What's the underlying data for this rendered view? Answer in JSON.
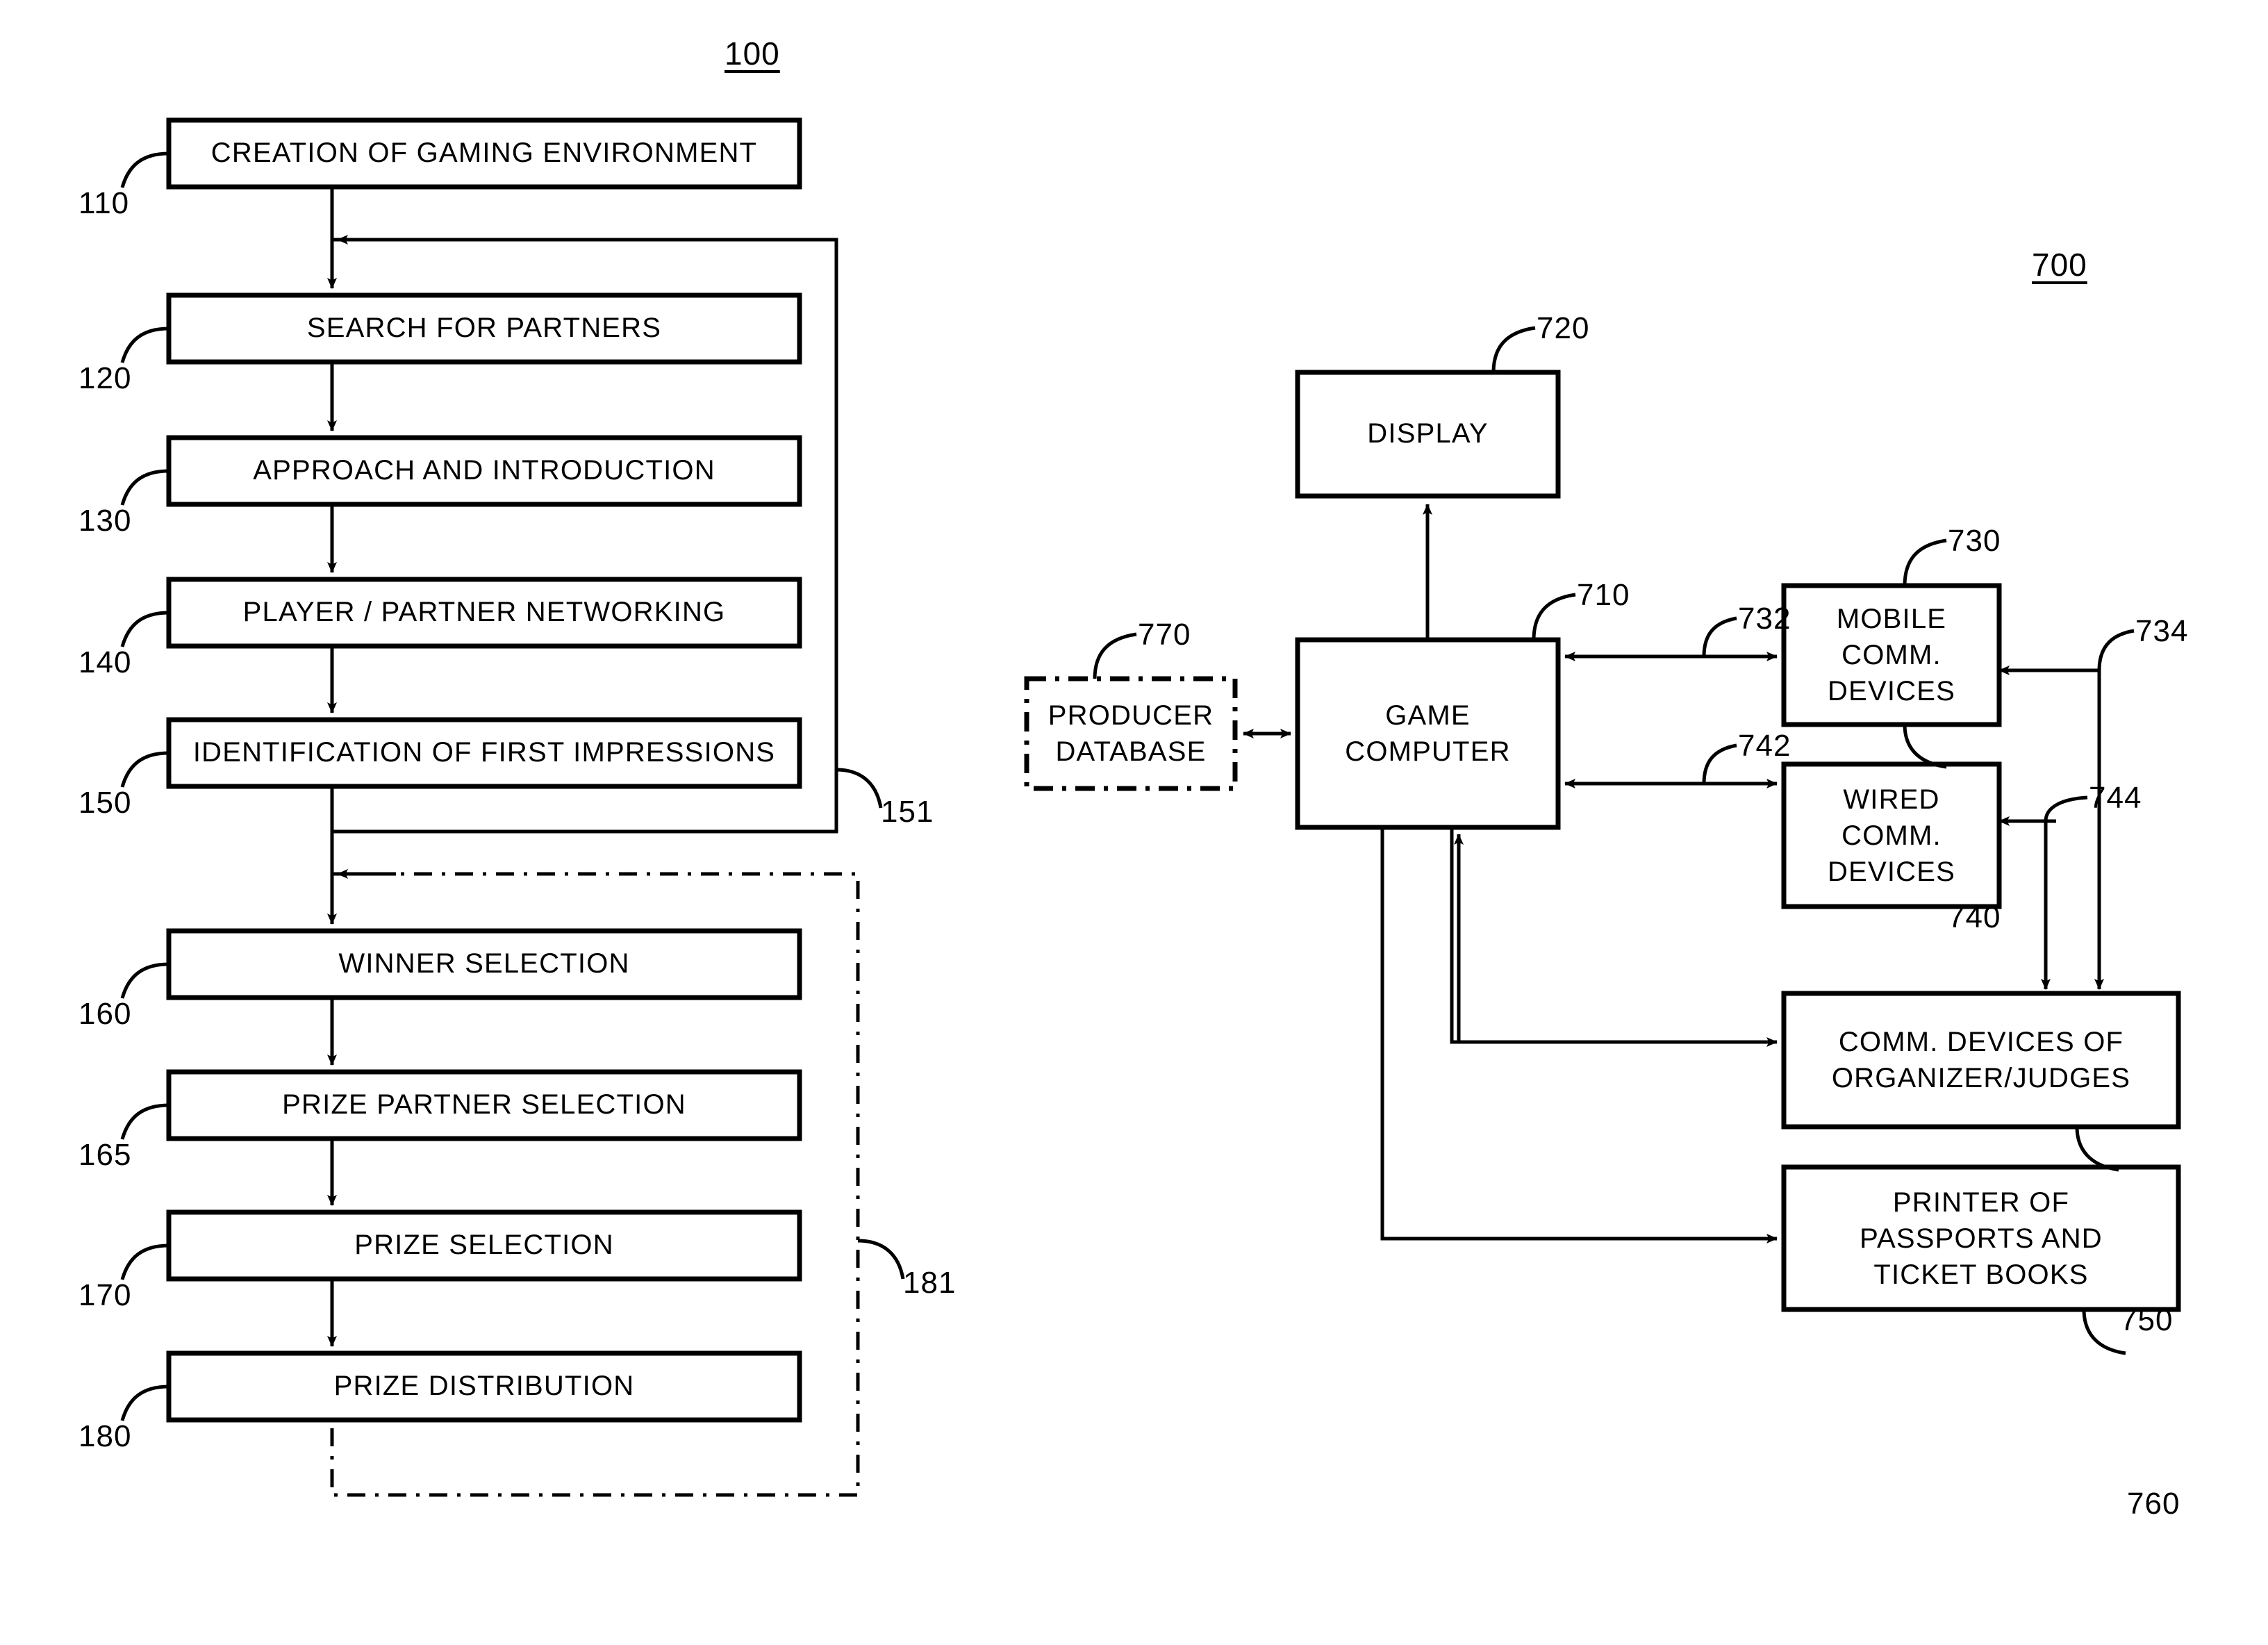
{
  "figures": {
    "flowchart": {
      "number": "100",
      "steps": [
        {
          "ref": "110",
          "label": "CREATION OF GAMING ENVIRONMENT"
        },
        {
          "ref": "120",
          "label": "SEARCH FOR PARTNERS"
        },
        {
          "ref": "130",
          "label": "APPROACH AND INTRODUCTION"
        },
        {
          "ref": "140",
          "label": "PLAYER / PARTNER NETWORKING"
        },
        {
          "ref": "150",
          "label": "IDENTIFICATION OF FIRST IMPRESSIONS"
        },
        {
          "ref": "160",
          "label": "WINNER SELECTION"
        },
        {
          "ref": "165",
          "label": "PRIZE PARTNER SELECTION"
        },
        {
          "ref": "170",
          "label": "PRIZE SELECTION"
        },
        {
          "ref": "180",
          "label": "PRIZE DISTRIBUTION"
        }
      ],
      "loops": [
        {
          "ref": "151",
          "kind": "solid-feedback"
        },
        {
          "ref": "181",
          "kind": "dashed-enclosure"
        }
      ]
    },
    "system": {
      "number": "700",
      "nodes": [
        {
          "ref": "720",
          "label": "DISPLAY",
          "style": "solid"
        },
        {
          "ref": "710",
          "label": "GAME\nCOMPUTER",
          "style": "solid"
        },
        {
          "ref": "770",
          "label": "PRODUCER\nDATABASE",
          "style": "dash-dot"
        },
        {
          "ref": "730",
          "label": "MOBILE\nCOMM.\nDEVICES",
          "style": "solid"
        },
        {
          "ref": "740",
          "label": "WIRED\nCOMM.\nDEVICES",
          "style": "solid"
        },
        {
          "ref": "750",
          "label": "COMM. DEVICES OF\nORGANIZER/JUDGES",
          "style": "solid"
        },
        {
          "ref": "760",
          "label": "PRINTER OF\nPASSPORTS AND\nTICKET BOOKS",
          "style": "solid"
        }
      ],
      "links": [
        {
          "ref": "732",
          "from": "710",
          "to": "730"
        },
        {
          "ref": "734",
          "from": "750",
          "to": "730"
        },
        {
          "ref": "742",
          "from": "710",
          "to": "740"
        },
        {
          "ref": "744",
          "from": "750",
          "to": "740"
        }
      ]
    }
  },
  "text": {
    "fig100": "100",
    "fig700": "700",
    "r110": "110",
    "r120": "120",
    "r130": "130",
    "r140": "140",
    "r150": "150",
    "r151": "151",
    "r160": "160",
    "r165": "165",
    "r170": "170",
    "r180": "180",
    "r181": "181",
    "r710": "710",
    "r720": "720",
    "r730": "730",
    "r732": "732",
    "r734": "734",
    "r740": "740",
    "r742": "742",
    "r744": "744",
    "r750": "750",
    "r760": "760",
    "r770": "770",
    "b110": "CREATION OF GAMING ENVIRONMENT",
    "b120": "SEARCH FOR PARTNERS",
    "b130": "APPROACH AND INTRODUCTION",
    "b140": "PLAYER / PARTNER NETWORKING",
    "b150": "IDENTIFICATION OF FIRST IMPRESSIONS",
    "b160": "WINNER SELECTION",
    "b165": "PRIZE PARTNER SELECTION",
    "b170": "PRIZE SELECTION",
    "b180": "PRIZE DISTRIBUTION",
    "n720": "DISPLAY",
    "n710l1": "GAME",
    "n710l2": "COMPUTER",
    "n770l1": "PRODUCER",
    "n770l2": "DATABASE",
    "n730l1": "MOBILE",
    "n730l2": "COMM.",
    "n730l3": "DEVICES",
    "n740l1": "WIRED",
    "n740l2": "COMM.",
    "n740l3": "DEVICES",
    "n750l1": "COMM. DEVICES OF",
    "n750l2": "ORGANIZER/JUDGES",
    "n760l1": "PRINTER OF",
    "n760l2": "PASSPORTS AND",
    "n760l3": "TICKET BOOKS"
  },
  "colors": {
    "ink": "#000000",
    "paper": "#ffffff"
  }
}
